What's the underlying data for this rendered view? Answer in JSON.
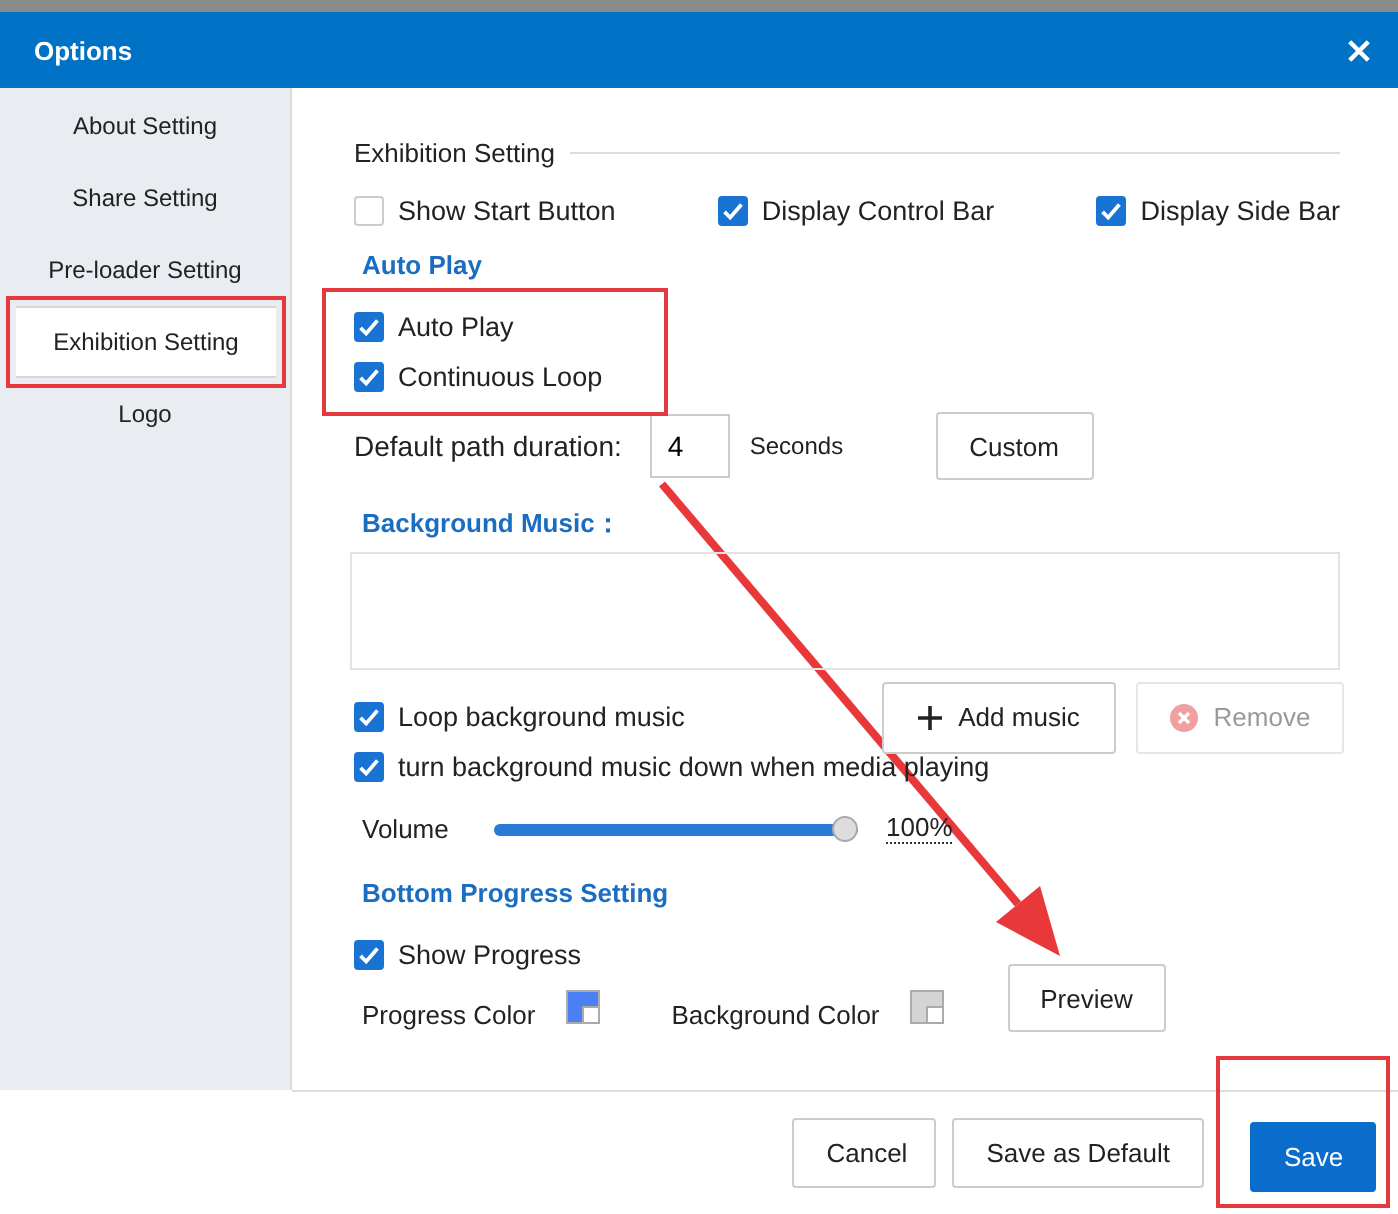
{
  "window": {
    "title": "Options"
  },
  "sidebar": {
    "items": [
      {
        "label": "About Setting",
        "selected": false,
        "highlighted": false
      },
      {
        "label": "Share Setting",
        "selected": false,
        "highlighted": false
      },
      {
        "label": "Pre-loader Setting",
        "selected": false,
        "highlighted": false
      },
      {
        "label": "Exhibition Setting",
        "selected": true,
        "highlighted": true
      },
      {
        "label": "Logo",
        "selected": false,
        "highlighted": false
      }
    ]
  },
  "exhibition": {
    "title": "Exhibition Setting",
    "options": [
      {
        "label": "Show Start Button",
        "checked": false
      },
      {
        "label": "Display Control Bar",
        "checked": true
      },
      {
        "label": "Display Side Bar",
        "checked": true
      }
    ]
  },
  "auto_play": {
    "heading": "Auto Play",
    "highlighted": true,
    "options": [
      {
        "label": "Auto Play",
        "checked": true
      },
      {
        "label": "Continuous Loop",
        "checked": true
      }
    ]
  },
  "duration": {
    "label": "Default path duration:",
    "value": "4",
    "unit": "Seconds",
    "button": "Custom"
  },
  "background_music": {
    "heading": "Background Music：",
    "options": [
      {
        "label": "Loop background music",
        "checked": true
      },
      {
        "label": "turn background music down when media playing",
        "checked": true
      }
    ],
    "add_button": "Add music",
    "remove_button": "Remove",
    "remove_disabled": true,
    "volume": {
      "label": "Volume",
      "level": 1,
      "reading": "100%"
    }
  },
  "bottom_progress": {
    "heading": "Bottom Progress Setting",
    "show_progress": {
      "label": "Show Progress",
      "checked": true
    },
    "progress_color": {
      "label": "Progress Color",
      "color": "#4a7ff5"
    },
    "background_color": {
      "label": "Background Color",
      "color": "#d4d4d4"
    },
    "preview_button": "Preview"
  },
  "footer": {
    "buttons": [
      {
        "label": "Cancel",
        "kind": "default",
        "highlighted": false
      },
      {
        "label": "Save as Default",
        "kind": "default",
        "highlighted": false
      },
      {
        "label": "Save",
        "kind": "primary",
        "highlighted": true
      }
    ]
  }
}
